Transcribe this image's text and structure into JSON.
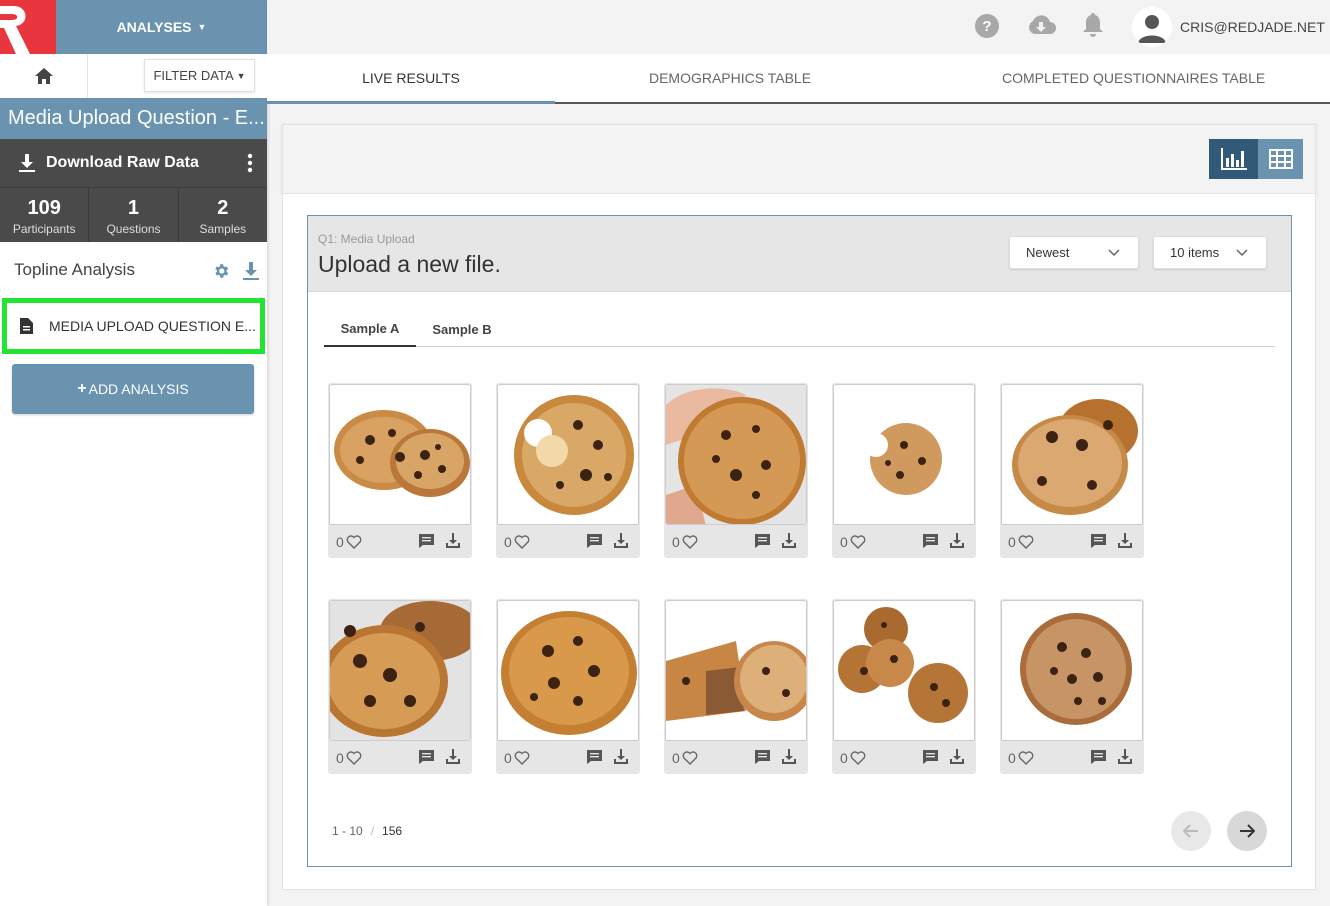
{
  "colors": {
    "accent": "#6993af",
    "dark_accent": "#305a78",
    "brand_red": "#e8353e",
    "highlight": "#22e532"
  },
  "nav": {
    "analyses_label": "ANALYSES",
    "filter_label": "FILTER DATA"
  },
  "user": {
    "email": "CRIS@REDJADE.NET"
  },
  "project": {
    "title": "Media Upload Question - E..."
  },
  "download": {
    "label": "Download Raw Data"
  },
  "stats": [
    {
      "value": "109",
      "label": "Participants"
    },
    {
      "value": "1",
      "label": "Questions"
    },
    {
      "value": "2",
      "label": "Samples"
    }
  ],
  "topline": {
    "label": "Topline Analysis"
  },
  "analysis_item": {
    "label": "MEDIA UPLOAD QUESTION E..."
  },
  "add_analysis": {
    "label": "ADD ANALYSIS"
  },
  "tabs": [
    {
      "label": "LIVE RESULTS",
      "active": true
    },
    {
      "label": "DEMOGRAPHICS TABLE",
      "active": false
    },
    {
      "label": "COMPLETED QUESTIONNAIRES TABLE",
      "active": false
    }
  ],
  "question": {
    "number": "Q1: Media Upload",
    "title": "Upload a new file.",
    "sort": "Newest",
    "page_size": "10 items"
  },
  "sample_tabs": [
    {
      "label": "Sample A",
      "active": true
    },
    {
      "label": "Sample B",
      "active": false
    }
  ],
  "uploads": [
    {
      "likes": "0",
      "image": "cookie-pair-photo"
    },
    {
      "likes": "0",
      "image": "bitten-cookie-photo"
    },
    {
      "likes": "0",
      "image": "hand-held-cookie-photo"
    },
    {
      "likes": "0",
      "image": "small-bitten-cookie-photo"
    },
    {
      "likes": "0",
      "image": "stacked-cookies-photo"
    },
    {
      "likes": "0",
      "image": "closeup-cookie-photo"
    },
    {
      "likes": "0",
      "image": "golden-cookie-photo"
    },
    {
      "likes": "0",
      "image": "broken-cookie-photo"
    },
    {
      "likes": "0",
      "image": "scattered-cookies-photo"
    },
    {
      "likes": "0",
      "image": "round-cookie-photo"
    }
  ],
  "pagination": {
    "range": "1 - 10",
    "separator": "/",
    "total": "156"
  }
}
